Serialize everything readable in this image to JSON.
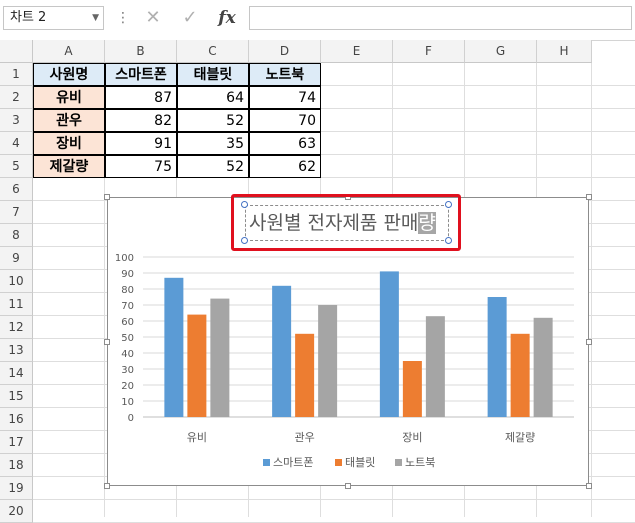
{
  "formula_bar": {
    "name_box": "차트 2",
    "dropdown_icon": "chevron-down-icon",
    "separator": "⋮",
    "cancel_icon": "✕",
    "enter_icon": "✓",
    "fx_label": "fx",
    "formula_value": ""
  },
  "columns": [
    "A",
    "B",
    "C",
    "D",
    "E",
    "F",
    "G",
    "H"
  ],
  "rows": [
    "1",
    "2",
    "3",
    "4",
    "5",
    "6",
    "7",
    "8",
    "9",
    "10",
    "11",
    "12",
    "13",
    "14",
    "15",
    "16",
    "17",
    "18",
    "19",
    "20"
  ],
  "table": {
    "headers": [
      "사원명",
      "스마트폰",
      "태블릿",
      "노트북"
    ],
    "rows": [
      {
        "name": "유비",
        "values": [
          "87",
          "64",
          "74"
        ]
      },
      {
        "name": "관우",
        "values": [
          "82",
          "52",
          "70"
        ]
      },
      {
        "name": "장비",
        "values": [
          "91",
          "35",
          "63"
        ]
      },
      {
        "name": "제갈량",
        "values": [
          "75",
          "52",
          "62"
        ]
      }
    ]
  },
  "colors": {
    "header_fill": "#ddebf7",
    "name_fill": "#fce4d6",
    "series_colors": [
      "#5b9bd5",
      "#ed7d31",
      "#a5a5a5"
    ],
    "highlight": "#e0101e"
  },
  "chart_data": {
    "type": "bar",
    "title_main": "사원별 전자제품 판매",
    "title_selected": "량",
    "categories": [
      "유비",
      "관우",
      "장비",
      "제갈량"
    ],
    "series": [
      {
        "name": "스마트폰",
        "values": [
          87,
          82,
          91,
          75
        ]
      },
      {
        "name": "태블릿",
        "values": [
          64,
          52,
          35,
          52
        ]
      },
      {
        "name": "노트북",
        "values": [
          74,
          70,
          63,
          62
        ]
      }
    ],
    "ylim": [
      0,
      100
    ],
    "yticks": [
      "0",
      "10",
      "20",
      "30",
      "40",
      "50",
      "60",
      "70",
      "80",
      "90",
      "100"
    ],
    "grid": true,
    "legend": "bottom"
  }
}
